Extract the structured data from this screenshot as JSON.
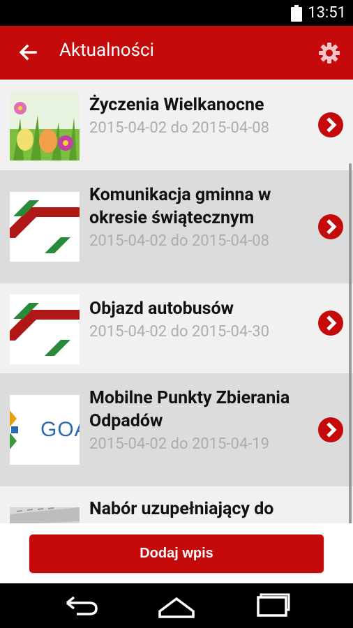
{
  "status_bar": {
    "time": "13:51"
  },
  "app_bar": {
    "title": "Aktualności",
    "back_icon": "back-arrow-icon",
    "settings_icon": "gear-icon"
  },
  "items": [
    {
      "title": "Życzenia Wielkanocne",
      "date": "2015-04-02 do 2015-04-08",
      "thumb": "easter-eggs-image"
    },
    {
      "title": "Komunikacja gminna w okresie świątecznym",
      "date": "2015-04-02 do 2015-04-08",
      "thumb": "stripes-logo"
    },
    {
      "title": "Objazd autobusów",
      "date": "2015-04-02 do 2015-04-30",
      "thumb": "stripes-logo"
    },
    {
      "title": "Mobilne Punkty Zbierania Odpadów",
      "date": "2015-04-02 do 2015-04-19",
      "thumb": "goa-logo",
      "thumb_text": "GOA"
    },
    {
      "title": "Nabór uzupełniający do",
      "date": "",
      "thumb": "keyboard-image"
    }
  ],
  "add_button": {
    "label": "Dodaj wpis"
  },
  "colors": {
    "accent": "#c40a0a",
    "row_light": "#f1f1f1",
    "row_dark": "#dcdcdc",
    "date_text": "#adadad"
  },
  "nav_bar": {
    "icons": [
      "back-nav-icon",
      "home-nav-icon",
      "recents-nav-icon"
    ]
  }
}
